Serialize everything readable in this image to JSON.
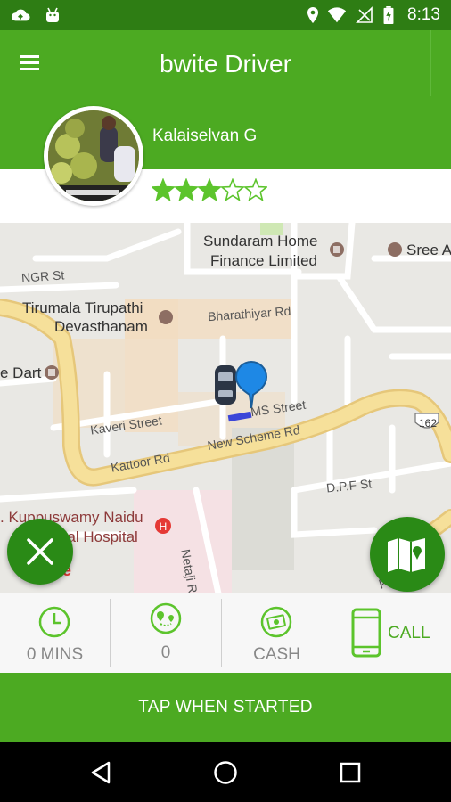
{
  "status_bar": {
    "time": "8:13",
    "icons": [
      "cloud-upload-icon",
      "android-icon",
      "location-icon",
      "wifi-icon",
      "no-signal-icon",
      "battery-charging-icon"
    ]
  },
  "app_bar": {
    "title": "bwite Driver",
    "menu_icon": "menu-icon"
  },
  "driver": {
    "name": "Kalaiselvan G",
    "rating": 3,
    "rating_max": 5
  },
  "map": {
    "labels": {
      "sundaram_1": "Sundaram Home",
      "sundaram_2": "Finance Limited",
      "sree": "Sree A",
      "ngr": "NGR St",
      "tirumala_1": "Tirumala Tirupathi",
      "tirumala_2": "Devasthanam",
      "bharathiyar": "Bharathiyar Rd",
      "dart": "e Dart",
      "kaveri": "Kaveri Street",
      "ms_street": "MS Street",
      "new_scheme": "New Scheme Rd",
      "kattoor": "Kattoor Rd",
      "road_162": "162",
      "dpf": "D.P.F St",
      "kuppuswamy_1": ". Kuppuswamy Naidu",
      "kuppuswamy_2": "rial Hospital",
      "netaji": "Netaji Rd",
      "google_fragment": "e",
      "a_fragment": "A"
    }
  },
  "info": {
    "time_value": "0 MINS",
    "distance_value": "0",
    "payment_value": "CASH",
    "call_label": "CALL"
  },
  "actions": {
    "start_label": "TAP WHEN STARTED"
  },
  "colors": {
    "primary": "#4caa22",
    "primary_dark": "#2e7d14",
    "fab": "#2a8a16",
    "star": "#5cc42c"
  }
}
